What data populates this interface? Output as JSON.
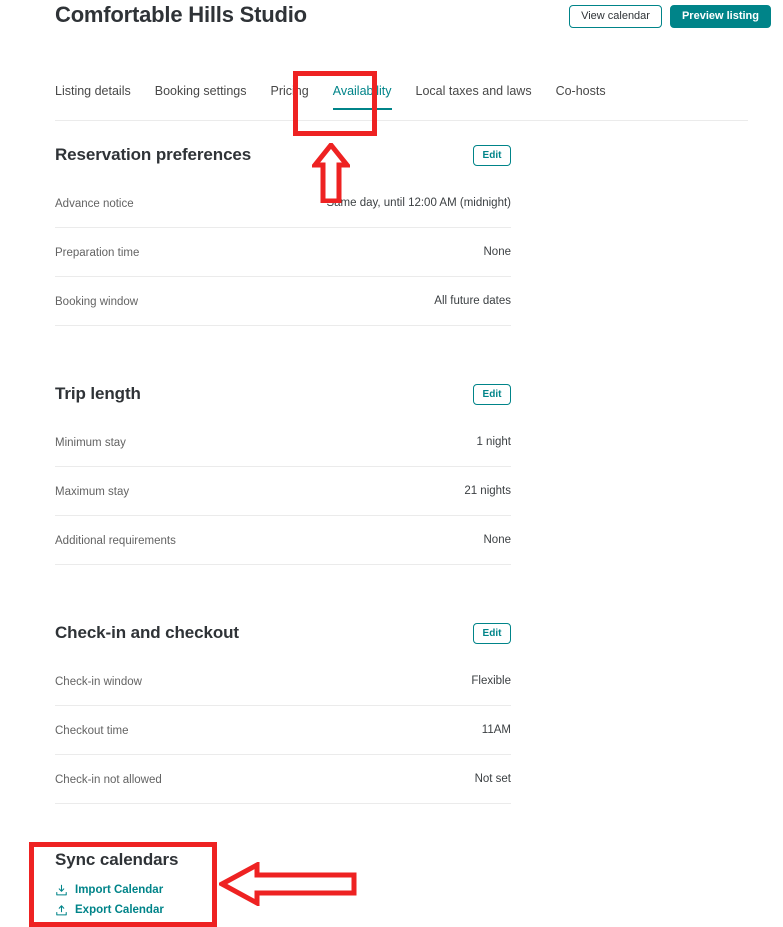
{
  "header": {
    "title": "Comfortable Hills Studio",
    "actions": [
      {
        "label": "View calendar",
        "name": "view-calendar-button",
        "style": "outline"
      },
      {
        "label": "Preview listing",
        "name": "preview-listing-button",
        "style": "primary"
      }
    ]
  },
  "tabs": [
    {
      "label": "Listing details",
      "active": false
    },
    {
      "label": "Booking settings",
      "active": false
    },
    {
      "label": "Pricing",
      "active": false
    },
    {
      "label": "Availability",
      "active": true
    },
    {
      "label": "Local taxes and laws",
      "active": false
    },
    {
      "label": "Co-hosts",
      "active": false
    }
  ],
  "sections": [
    {
      "title": "Reservation preferences",
      "edit_label": "Edit",
      "rows": [
        {
          "label": "Advance notice",
          "value": "Same day, until 12:00 AM (midnight)"
        },
        {
          "label": "Preparation time",
          "value": "None"
        },
        {
          "label": "Booking window",
          "value": "All future dates"
        }
      ]
    },
    {
      "title": "Trip length",
      "edit_label": "Edit",
      "rows": [
        {
          "label": "Minimum stay",
          "value": "1 night"
        },
        {
          "label": "Maximum stay",
          "value": "21 nights"
        },
        {
          "label": "Additional requirements",
          "value": "None"
        }
      ]
    },
    {
      "title": "Check-in and checkout",
      "edit_label": "Edit",
      "rows": [
        {
          "label": "Check-in window",
          "value": "Flexible"
        },
        {
          "label": "Checkout time",
          "value": "11AM"
        },
        {
          "label": "Check-in not allowed",
          "value": "Not set"
        }
      ]
    }
  ],
  "sync_calendars": {
    "title": "Sync calendars",
    "links": [
      {
        "label": "Import Calendar",
        "icon": "import-calendar-icon"
      },
      {
        "label": "Export Calendar",
        "icon": "export-calendar-icon"
      }
    ]
  },
  "annotations": [
    {
      "name": "annotation-box-availability-tab",
      "shape": "rectangle",
      "color": "#ee2222"
    },
    {
      "name": "annotation-arrow-up-availability",
      "shape": "arrow-up",
      "color": "#ee2222"
    },
    {
      "name": "annotation-box-sync-calendars",
      "shape": "rectangle",
      "color": "#ee2222"
    },
    {
      "name": "annotation-arrow-left-sync-calendars",
      "shape": "arrow-left",
      "color": "#ee2222"
    }
  ],
  "colors": {
    "accent_teal": "#008489",
    "annotation_red": "#ee2222",
    "text_primary": "#2f3337",
    "text_secondary": "#636363",
    "divider": "#ebebeb"
  }
}
